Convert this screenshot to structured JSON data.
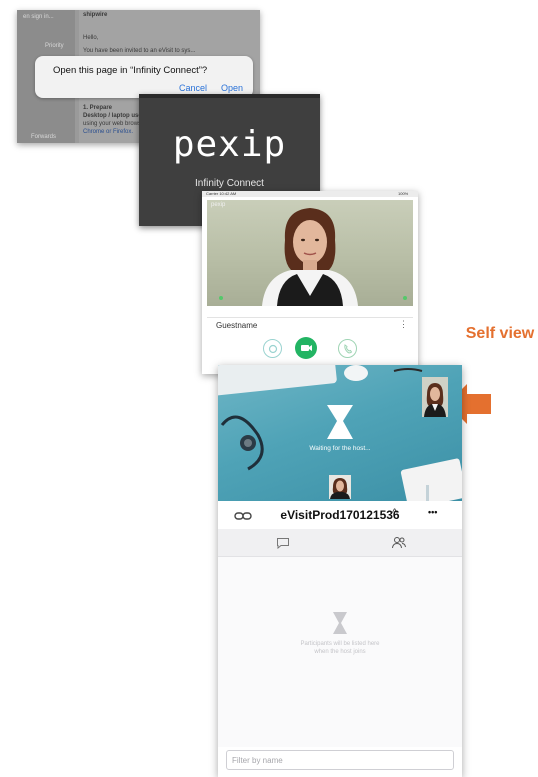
{
  "screenshot_browser": {
    "sidebar_items": [
      "en sign in...",
      "Priority",
      "Forwards"
    ],
    "doc_lines": [
      "shipwire",
      "Hello,",
      "You have been invited to an eVisit to sys...",
      "1. Prepare",
      "Desktop / laptop users",
      "using your web browser",
      "Chrome or Firefox."
    ],
    "dialog": {
      "message": "Open this page in “Infinity Connect”?",
      "cancel_label": "Cancel",
      "open_label": "Open"
    }
  },
  "screenshot_splash": {
    "logo": "pexip",
    "subtitle": "Infinity Connect"
  },
  "screenshot_preview": {
    "status_left": "Carrier  10:42 AM",
    "status_right": "100%",
    "brand_watermark": "pexip",
    "participant_name": "Guestname",
    "more_label": "⋮",
    "buttons": {
      "settings_icon": "settings-circle-icon",
      "camera_icon": "video-camera-icon",
      "call_icon": "phone-icon"
    }
  },
  "annotation": {
    "label": "Self view",
    "color": "#e4702f"
  },
  "screenshot_call": {
    "waiting_text": "Waiting for the host...",
    "link_icon": "link-icon",
    "conference_title": "eVisitProd170121536",
    "expand_label": "^",
    "more_label": "•••",
    "tabs": [
      {
        "name": "chat",
        "icon": "chat-bubble-icon"
      },
      {
        "name": "participants",
        "icon": "participants-icon"
      }
    ],
    "empty_text": "Participants will be listed here when the host joins",
    "filter_placeholder": "Filter by name",
    "accent_color": "#22b463"
  }
}
